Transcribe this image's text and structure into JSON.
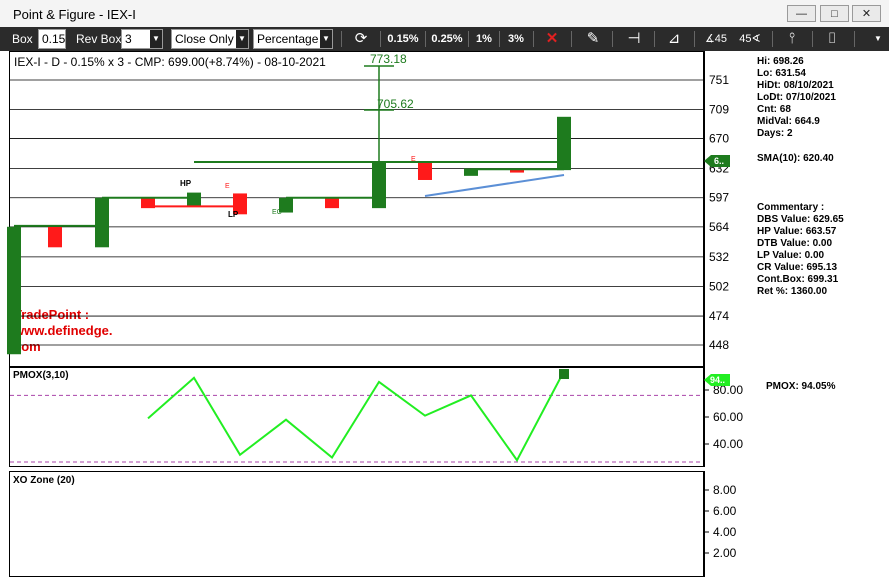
{
  "window": {
    "title": "Point & Figure - IEX-I",
    "minimize": "—",
    "maximize": "□",
    "close": "✕"
  },
  "toolbar": {
    "box_label": "Box",
    "box_value": "0.15",
    "revbox_label": "Rev Box",
    "revbox_value": "3",
    "method_value": "Close Only",
    "scale_value": "Percentage",
    "pct_options": [
      "0.15%",
      "0.25%",
      "1%",
      "3%"
    ],
    "icons": [
      "refresh-icon",
      "close-red-icon",
      "edit-icon",
      "pin-icon",
      "trendline-icon",
      "angle-45-left-icon",
      "angle-45-right-icon",
      "vertical-line-icon",
      "horizontal-measure-icon"
    ]
  },
  "chart": {
    "header": "IEX-I - D - 0.15% x 3 - CMP: 699.00(+8.74%) - 08-10-2021",
    "yaxis_labels": [
      "751",
      "709",
      "670",
      "632",
      "597",
      "564",
      "532",
      "502",
      "474",
      "448"
    ],
    "current_price_tag": "6..",
    "target_labels": [
      "773.18",
      "705.62"
    ],
    "pattern_labels": [
      "HP",
      "LP",
      "EC",
      "E",
      "E"
    ],
    "watermark": [
      "TradePoint :",
      "www.definedge.",
      "com"
    ]
  },
  "stats": {
    "hi": "Hi: 698.26",
    "lo": "Lo: 631.54",
    "hidt": "HiDt: 08/10/2021",
    "lodt": "LoDt: 07/10/2021",
    "cnt": "Cnt: 68",
    "midval": "MidVal: 664.9",
    "days": "Days: 2",
    "sma": "SMA(10): 620.40"
  },
  "commentary": {
    "title": "Commentary :",
    "dbs": "DBS Value:  629.65",
    "hp": "HP Value: 663.57",
    "dtb": "DTB Value: 0.00",
    "lp": "LP Value: 0.00",
    "cr": "CR Value: 695.13",
    "contbox": "Cont.Box: 699.31",
    "ret": "Ret %: 1360.00"
  },
  "pmox": {
    "title": "PMOX(3,10)",
    "value_text": "PMOX: 94.05%",
    "tag": "94..",
    "yaxis_labels": [
      "80.00",
      "60.00",
      "40.00"
    ]
  },
  "xozone": {
    "title": "XO Zone (20)",
    "yaxis_labels": [
      "8.00",
      "6.00",
      "4.00",
      "2.00"
    ]
  },
  "colors": {
    "up": "#1e7b1e",
    "down": "#ff1a1a",
    "pmox_line": "#22ee22",
    "sma_line": "#5b8fd6",
    "dashed": "#aa44aa",
    "toolbar": "#2b2b2b"
  },
  "chart_data": {
    "type": "candlestick-pnf",
    "up_color": "#1e7b1e",
    "down_color": "#ff1a1a",
    "main_ylim": [
      437,
      800
    ],
    "columns": [
      {
        "x": 0,
        "dir": "up",
        "low": 440,
        "high": 564
      },
      {
        "x": 1,
        "dir": "down",
        "low": 542,
        "high": 564
      },
      {
        "x": 2,
        "dir": "up",
        "low": 542,
        "high": 597
      },
      {
        "x": 3,
        "dir": "down",
        "low": 585,
        "high": 597
      },
      {
        "x": 4,
        "dir": "up",
        "low": 587,
        "high": 603
      },
      {
        "x": 5,
        "dir": "down",
        "low": 578,
        "high": 602
      },
      {
        "x": 6,
        "dir": "up",
        "low": 580,
        "high": 597
      },
      {
        "x": 7,
        "dir": "down",
        "low": 585,
        "high": 597
      },
      {
        "x": 8,
        "dir": "up",
        "low": 585,
        "high": 640
      },
      {
        "x": 9,
        "dir": "down",
        "low": 618,
        "high": 640
      },
      {
        "x": 10,
        "dir": "up",
        "low": 623,
        "high": 632
      },
      {
        "x": 11,
        "dir": "down",
        "low": 627,
        "high": 632
      },
      {
        "x": 12,
        "dir": "up",
        "low": 630,
        "high": 699
      }
    ],
    "pmox_values": [
      59,
      89,
      32,
      58,
      30,
      86,
      61,
      76,
      28,
      94
    ],
    "pmox_ylim": [
      20,
      102
    ],
    "pmox_levels": [
      76,
      20
    ]
  }
}
